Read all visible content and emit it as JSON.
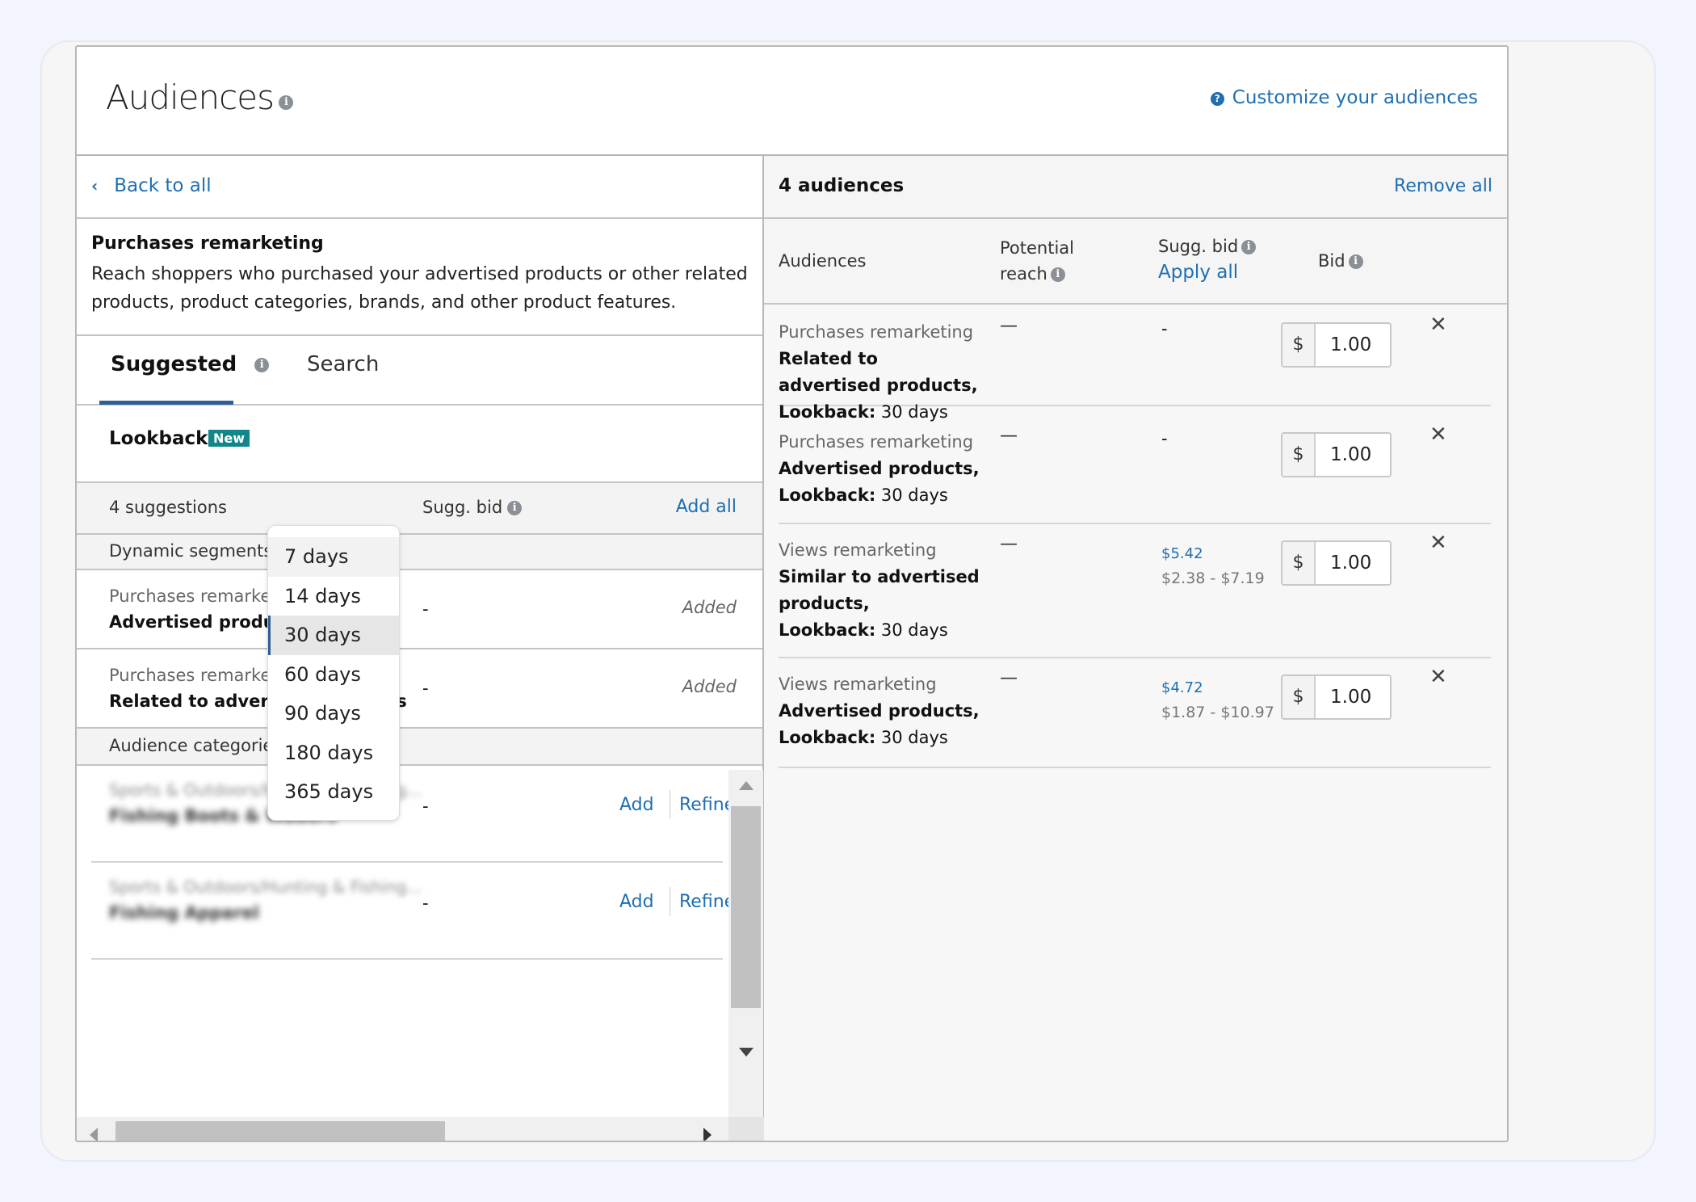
{
  "header": {
    "title": "Audiences",
    "customize_link": "Customize your audiences"
  },
  "left": {
    "back_label": "Back to all",
    "description": {
      "title": "Purchases remarketing",
      "text": "Reach shoppers who purchased your advertised products or other related products, product categories, brands, and other product features."
    },
    "tabs": [
      {
        "label": "Suggested",
        "active": true
      },
      {
        "label": "Search",
        "active": false
      }
    ],
    "lookback": {
      "label": "Lookback",
      "badge": "New",
      "dropdown": {
        "options": [
          "7 days",
          "14 days",
          "30 days",
          "60 days",
          "90 days",
          "180 days",
          "365 days"
        ],
        "selected": "30 days",
        "hovered": "7 days"
      }
    },
    "suggestions_header": {
      "count_label": "4 suggestions",
      "sugg_bid_label": "Sugg. bid",
      "add_all_label": "Add all"
    },
    "dynamic_segments": {
      "label": "Dynamic segments",
      "rows": [
        {
          "type": "Purchases remarketing",
          "name": "Advertised products",
          "sugg_bid": "-",
          "status": "Added"
        },
        {
          "type": "Purchases remarketing",
          "name": "Related to advertised products",
          "sugg_bid": "-",
          "status": "Added"
        }
      ]
    },
    "audience_categories": {
      "label": "Audience categories",
      "rows": [
        {
          "path": "Sports & Outdoors/Hunting & Fishing...",
          "name": "Fishing Boots & Waders",
          "sugg_bid": "-",
          "add_label": "Add",
          "refine_label": "Refine"
        },
        {
          "path": "Sports & Outdoors/Hunting & Fishing...",
          "name": "Fishing Apparel",
          "sugg_bid": "-",
          "add_label": "Add",
          "refine_label": "Refine"
        }
      ]
    }
  },
  "right": {
    "count_label": "4 audiences",
    "remove_all_label": "Remove all",
    "columns": {
      "audiences": "Audiences",
      "reach_line1": "Potential",
      "reach_line2": "reach",
      "sugg_bid": "Sugg. bid",
      "apply_all": "Apply all",
      "bid": "Bid"
    },
    "lookback_prefix": "Lookback:",
    "currency": "$",
    "rows": [
      {
        "type": "Purchases remarketing",
        "name": "Related to advertised products,",
        "lookback": "30 days",
        "reach": "—",
        "sugg_bid": "-",
        "sugg_range": "",
        "bid": "1.00"
      },
      {
        "type": "Purchases remarketing",
        "name": "Advertised products,",
        "lookback": "30 days",
        "reach": "—",
        "sugg_bid": "-",
        "sugg_range": "",
        "bid": "1.00"
      },
      {
        "type": "Views remarketing",
        "name": "Similar to advertised products,",
        "lookback": "30 days",
        "reach": "—",
        "sugg_bid": "$5.42",
        "sugg_range": "$2.38 - $7.19",
        "bid": "1.00"
      },
      {
        "type": "Views remarketing",
        "name": "Advertised products,",
        "lookback": "30 days",
        "reach": "—",
        "sugg_bid": "$4.72",
        "sugg_range": "$1.87 - $10.97",
        "bid": "1.00"
      }
    ]
  },
  "icons": {
    "info": "i",
    "help": "?",
    "back": "‹",
    "close": "✕"
  }
}
